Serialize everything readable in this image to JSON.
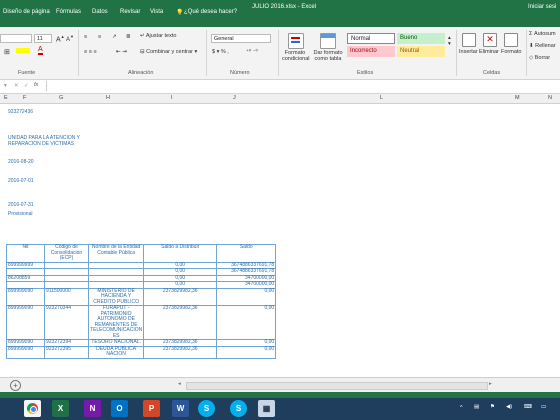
{
  "window": {
    "title": "JULIO 2016.xlsx - Excel",
    "signin": "Iniciar sesi"
  },
  "tabs": [
    "Diseño de página",
    "Fórmulas",
    "Datos",
    "Revisar",
    "Vista",
    "¿Qué desea hacer?"
  ],
  "ribbon": {
    "font_size": "11",
    "wrap_text": "Ajustar texto",
    "merge_center": "Combinar y centrar",
    "number_format": "General",
    "cond_format": "Formato condicional",
    "format_table": "Dar formato como tabla",
    "styles": {
      "normal": "Normal",
      "good": "Bueno",
      "bad": "Incorrecto",
      "neutral": "Neutral"
    },
    "insert": "Insertar",
    "delete": "Eliminar",
    "format": "Formato",
    "autosum": "Autosum",
    "fill": "Rellenar",
    "clear": "Borrar",
    "groups": {
      "font": "Fuente",
      "alignment": "Alineación",
      "number": "Número",
      "styles": "Estilos",
      "cells": "Celdas"
    }
  },
  "columns": [
    "E",
    "F",
    "G",
    "H",
    "I",
    "J",
    "L",
    "M",
    "N"
  ],
  "header_block": {
    "nit": "923272436",
    "entity_line1": "UNIDAD PARA LA ATENCION Y",
    "entity_line2": "REPARACION DE VICTIMAS",
    "date1": "2016-08-20",
    "date2": "2016-07-01",
    "date3": "2016-07-31",
    "status": "Provisional"
  },
  "table": {
    "headers": [
      "Nit",
      "Código de Consolidación (ECP)",
      "Nombre de la Entidad Contable Pública",
      "Saldo a Distribuir",
      "Saldo"
    ],
    "rows": [
      {
        "nit": "899999999",
        "code": "",
        "name": "",
        "dist": "0,00",
        "saldo": "3674886337691,78"
      },
      {
        "nit": "",
        "code": "",
        "name": "",
        "dist": "0,00",
        "saldo": "3674886337691,78"
      },
      {
        "nit": "86208859",
        "code": "",
        "name": "",
        "dist": "0,00",
        "saldo": "34700000,00"
      },
      {
        "nit": "",
        "code": "",
        "name": "",
        "dist": "0,00",
        "saldo": "34700000,00"
      },
      {
        "nit": "899999090",
        "code": "911500000",
        "name": "MINISTERIO DE HACIENDA Y CREDITO PUBLICO",
        "dist": "2373829982,36",
        "saldo": "0,00"
      },
      {
        "nit": "899999090",
        "code": "923270344",
        "name": "FURAPUT - PATRIMONIO AUTONOMO DE REMANENTES DE TELECOMUNICACION ES",
        "dist": "2373829982,36",
        "saldo": "0,00"
      },
      {
        "nit": "899999090",
        "code": "923272394",
        "name": "TESORO NACIONAL.",
        "dist": "2373829982,36",
        "saldo": "0,00"
      },
      {
        "nit": "899999090",
        "code": "923272395",
        "name": "DEUDA PUBLICA NACION",
        "dist": "2373829982,36",
        "saldo": "0,00"
      }
    ]
  },
  "taskbar_apps": [
    "chrome-icon",
    "excel-icon",
    "onenote-icon",
    "outlook-icon",
    "powerpoint-icon",
    "word-icon",
    "skype-icon",
    "skype-icon",
    "network-icon"
  ],
  "colors": {
    "excel_green": "#217346",
    "taskbar": "#1f3e5e",
    "link_blue": "#2f6ea8"
  }
}
